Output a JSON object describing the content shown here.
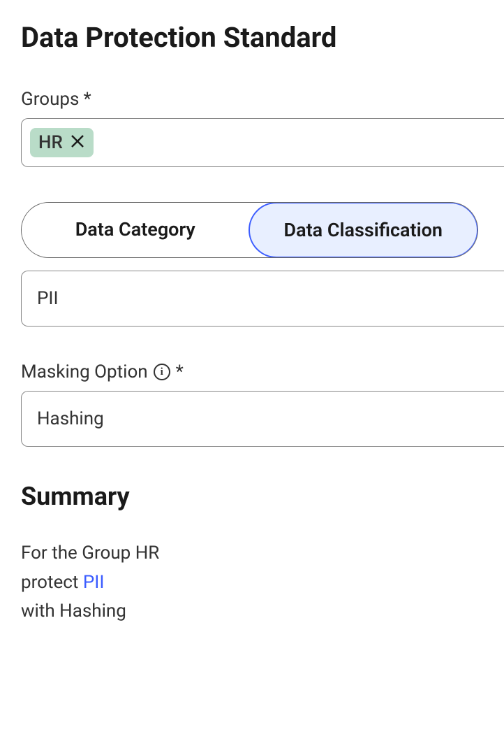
{
  "title": "Data Protection Standard",
  "groups": {
    "label": "Groups",
    "required": "*",
    "chip": {
      "text": "HR"
    }
  },
  "tabs": {
    "category": "Data Category",
    "classification": "Data Classification"
  },
  "classification_value": "PII",
  "masking": {
    "label": "Masking Option",
    "required": "*",
    "value": "Hashing"
  },
  "summary": {
    "title": "Summary",
    "line1_prefix": "For the Group ",
    "line1_value": "HR",
    "line2_prefix": "protect ",
    "line2_value": "PII",
    "line3_prefix": "with ",
    "line3_value": "Hashing"
  }
}
